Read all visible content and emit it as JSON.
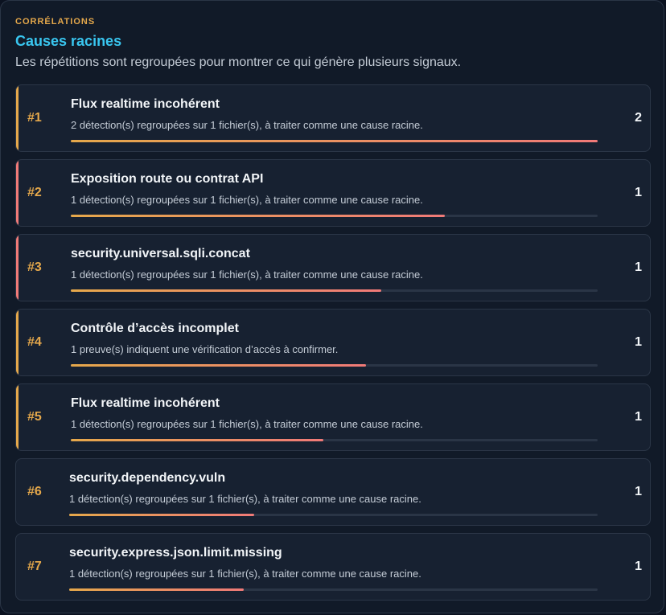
{
  "header": {
    "eyebrow": "CORRÉLATIONS",
    "title": "Causes racines",
    "subtitle": "Les répétitions sont regroupées pour montrer ce qui génère plusieurs signaux."
  },
  "colors": {
    "amber": "#e5a84b",
    "coral": "#f07a78",
    "title_blue": "#39c6f0"
  },
  "items": [
    {
      "rank": "#1",
      "title": "Flux realtime incohérent",
      "description": "2 détection(s) regroupées sur 1 fichier(s), à traiter comme une cause racine.",
      "count": "2",
      "level": 1.0,
      "accent": "#e5a84b"
    },
    {
      "rank": "#2",
      "title": "Exposition route ou contrat API",
      "description": "1 détection(s) regroupées sur 1 fichier(s), à traiter comme une cause racine.",
      "count": "1",
      "level": 0.71,
      "accent": "#f07a78"
    },
    {
      "rank": "#3",
      "title": "security.universal.sqli.concat",
      "description": "1 détection(s) regroupées sur 1 fichier(s), à traiter comme une cause racine.",
      "count": "1",
      "level": 0.59,
      "accent": "#f07a78"
    },
    {
      "rank": "#4",
      "title": "Contrôle d’accès incomplet",
      "description": "1 preuve(s) indiquent une vérification d’accès à confirmer.",
      "count": "1",
      "level": 0.56,
      "accent": "#e5a84b"
    },
    {
      "rank": "#5",
      "title": "Flux realtime incohérent",
      "description": "1 détection(s) regroupées sur 1 fichier(s), à traiter comme une cause racine.",
      "count": "1",
      "level": 0.48,
      "accent": "#e5a84b"
    },
    {
      "rank": "#6",
      "title": "security.dependency.vuln",
      "description": "1 détection(s) regroupées sur 1 fichier(s), à traiter comme une cause racine.",
      "count": "1",
      "level": 0.35,
      "accent": ""
    },
    {
      "rank": "#7",
      "title": "security.express.json.limit.missing",
      "description": "1 détection(s) regroupées sur 1 fichier(s), à traiter comme une cause racine.",
      "count": "1",
      "level": 0.33,
      "accent": ""
    }
  ]
}
